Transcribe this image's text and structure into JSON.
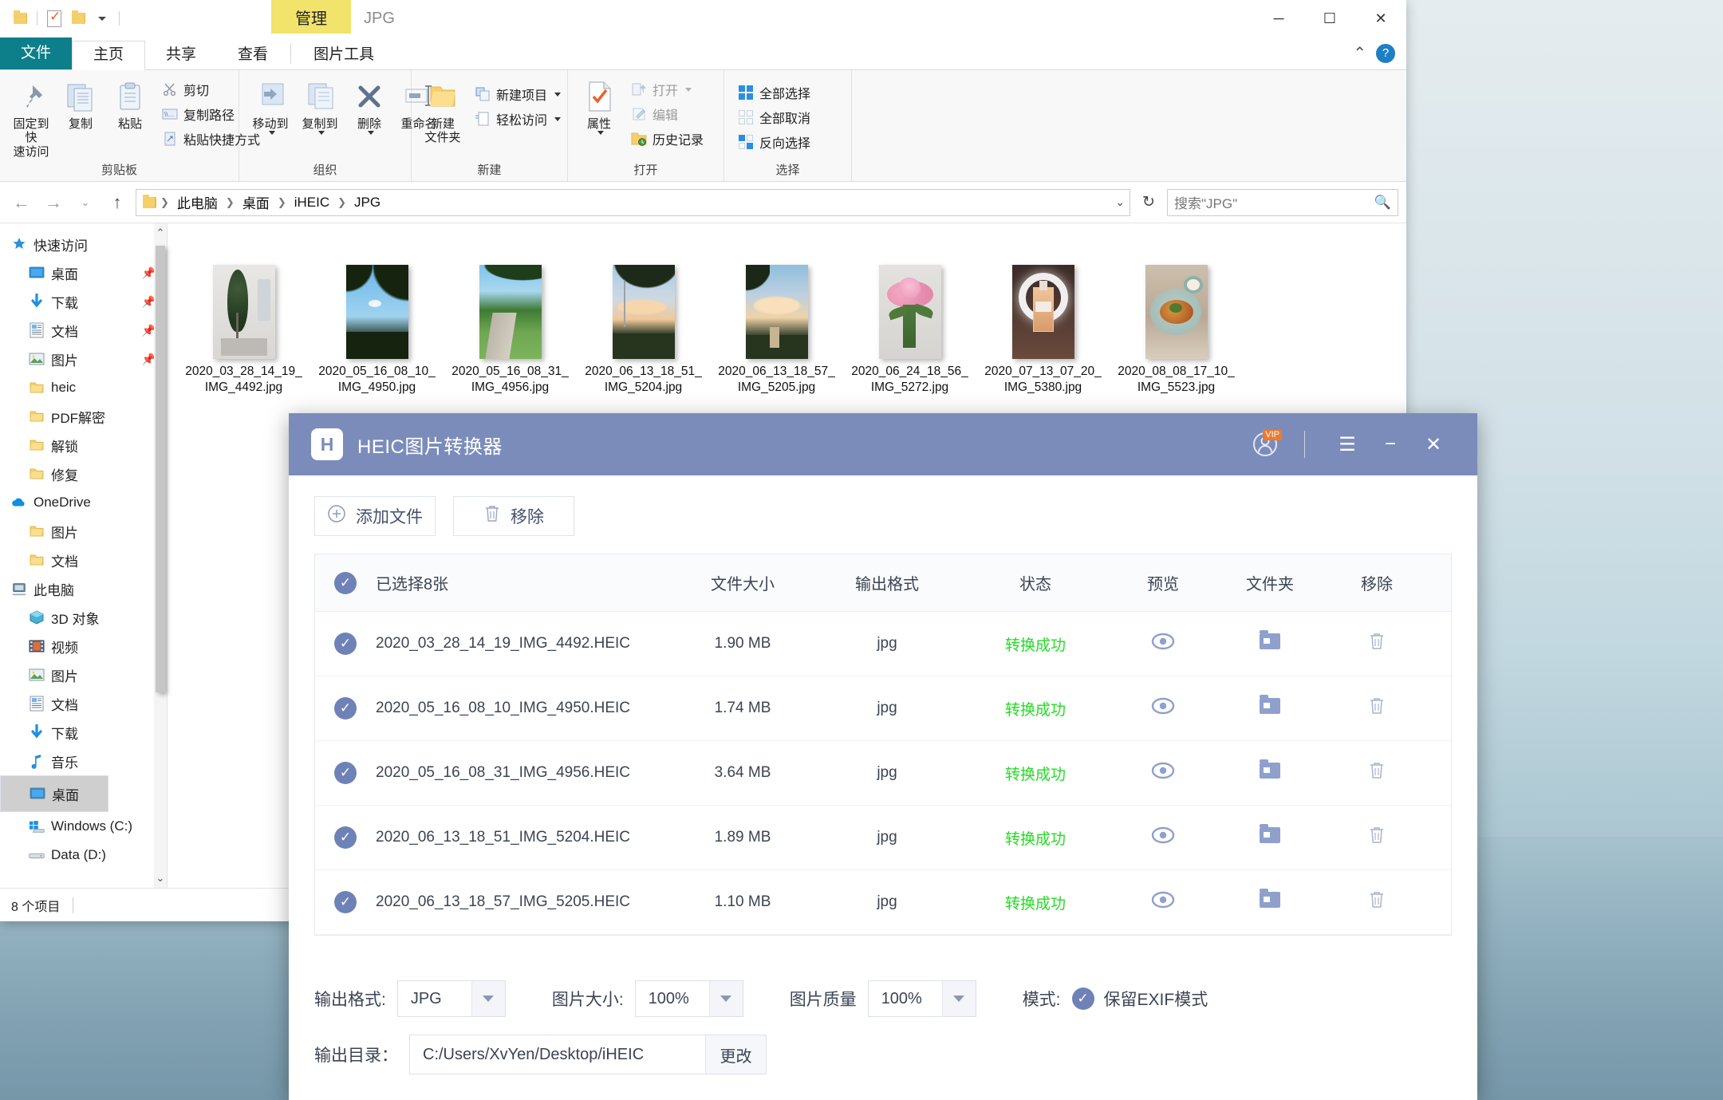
{
  "explorer": {
    "quick_access_toolbar": {
      "folder_icon": "folder-icon",
      "properties_icon": "properties-checkmark-icon",
      "new_folder_icon": "new-folder-icon",
      "customize_icon": "chevron-down-icon"
    },
    "contextual_tab": "管理",
    "contextual_caption": "JPG",
    "window_buttons": {
      "minimize": "─",
      "maximize": "☐",
      "close": "✕"
    },
    "ribbon_tabs": [
      {
        "label": "文件",
        "state": "file"
      },
      {
        "label": "主页",
        "state": "active"
      },
      {
        "label": "共享",
        "state": "normal"
      },
      {
        "label": "查看",
        "state": "normal"
      },
      {
        "label": "图片工具",
        "state": "contextual"
      }
    ],
    "ribbon_right": {
      "collapse": "⌃",
      "help": "?"
    },
    "ribbon_groups": [
      {
        "label": "剪贴板",
        "big": [
          {
            "label": "固定到快\n速访问",
            "icon": "pin-icon"
          },
          {
            "label": "复制",
            "icon": "copy-icon"
          },
          {
            "label": "粘贴",
            "icon": "paste-icon"
          }
        ],
        "small": [
          {
            "label": "剪切",
            "icon": "scissors-icon"
          },
          {
            "label": "复制路径",
            "icon": "copy-path-icon"
          },
          {
            "label": "粘贴快捷方式",
            "icon": "paste-shortcut-icon"
          }
        ]
      },
      {
        "label": "组织",
        "big": [
          {
            "label": "移动到",
            "icon": "move-to-icon",
            "dropdown": true
          },
          {
            "label": "复制到",
            "icon": "copy-to-icon",
            "dropdown": true
          },
          {
            "label": "删除",
            "icon": "delete-x-icon",
            "dropdown": true
          },
          {
            "label": "重命名",
            "icon": "rename-icon"
          }
        ],
        "small": []
      },
      {
        "label": "新建",
        "big": [
          {
            "label": "新建\n文件夹",
            "icon": "new-folder-icon"
          }
        ],
        "small": [
          {
            "label": "新建项目",
            "icon": "new-item-icon",
            "dropdown": true
          },
          {
            "label": "轻松访问",
            "icon": "easy-access-icon",
            "dropdown": true
          }
        ]
      },
      {
        "label": "打开",
        "big": [
          {
            "label": "属性",
            "icon": "properties-icon",
            "dropdown": true
          }
        ],
        "small": [
          {
            "label": "打开",
            "icon": "open-icon",
            "dropdown": true,
            "dim": true
          },
          {
            "label": "编辑",
            "icon": "edit-icon",
            "dim": true
          },
          {
            "label": "历史记录",
            "icon": "history-icon"
          }
        ]
      },
      {
        "label": "选择",
        "big": [],
        "small": [
          {
            "label": "全部选择",
            "icon": "select-all-icon"
          },
          {
            "label": "全部取消",
            "icon": "select-none-icon",
            "dim": true
          },
          {
            "label": "反向选择",
            "icon": "invert-selection-icon"
          }
        ]
      }
    ],
    "address": {
      "back_icon": "back-arrow-icon",
      "forward_icon": "forward-arrow-icon",
      "recent_icon": "chevron-down-icon",
      "up_icon": "up-arrow-icon",
      "breadcrumbs": [
        "此电脑",
        "桌面",
        "iHEIC",
        "JPG"
      ],
      "dropdown_icon": "chevron-down-icon",
      "refresh_icon": "refresh-icon",
      "search_placeholder": "搜索\"JPG\"",
      "search_icon": "search-icon"
    },
    "nav_pane": [
      {
        "label": "快速访问",
        "icon": "star-pin-icon",
        "level": 0,
        "pinned": false
      },
      {
        "label": "桌面",
        "icon": "desktop-icon",
        "level": 1,
        "pinned": true
      },
      {
        "label": "下载",
        "icon": "download-arrow-icon",
        "level": 1,
        "pinned": true
      },
      {
        "label": "文档",
        "icon": "documents-icon",
        "level": 1,
        "pinned": true
      },
      {
        "label": "图片",
        "icon": "pictures-icon",
        "level": 1,
        "pinned": true
      },
      {
        "label": "heic",
        "icon": "folder-icon",
        "level": 1,
        "pinned": false
      },
      {
        "label": "PDF解密",
        "icon": "folder-icon",
        "level": 1,
        "pinned": false
      },
      {
        "label": "解锁",
        "icon": "folder-icon",
        "level": 1,
        "pinned": false
      },
      {
        "label": "修复",
        "icon": "folder-icon",
        "level": 1,
        "pinned": false
      },
      {
        "label": "OneDrive",
        "icon": "onedrive-cloud-icon",
        "level": 0,
        "pinned": false
      },
      {
        "label": "图片",
        "icon": "folder-icon",
        "level": 1,
        "pinned": false
      },
      {
        "label": "文档",
        "icon": "folder-icon",
        "level": 1,
        "pinned": false
      },
      {
        "label": "此电脑",
        "icon": "this-pc-icon",
        "level": 0,
        "pinned": false
      },
      {
        "label": "3D 对象",
        "icon": "3d-objects-icon",
        "level": 1,
        "pinned": false
      },
      {
        "label": "视频",
        "icon": "videos-icon",
        "level": 1,
        "pinned": false
      },
      {
        "label": "图片",
        "icon": "pictures-icon",
        "level": 1,
        "pinned": false
      },
      {
        "label": "文档",
        "icon": "documents-icon",
        "level": 1,
        "pinned": false
      },
      {
        "label": "下载",
        "icon": "download-arrow-icon",
        "level": 1,
        "pinned": false
      },
      {
        "label": "音乐",
        "icon": "music-note-icon",
        "level": 1,
        "pinned": false
      },
      {
        "label": "桌面",
        "icon": "desktop-icon",
        "level": 1,
        "pinned": false,
        "selected": true
      },
      {
        "label": "Windows (C:)",
        "icon": "windows-drive-icon",
        "level": 1,
        "pinned": false
      },
      {
        "label": "Data (D:)",
        "icon": "drive-icon",
        "level": 1,
        "pinned": false
      }
    ],
    "files": [
      {
        "name": "2020_03_28_14_19_IMG_4492.jpg",
        "thumb": "interior-tree-cafe"
      },
      {
        "name": "2020_05_16_08_10_IMG_4950.jpg",
        "thumb": "palm-sky"
      },
      {
        "name": "2020_05_16_08_31_IMG_4956.jpg",
        "thumb": "park-path"
      },
      {
        "name": "2020_06_13_18_51_IMG_5204.jpg",
        "thumb": "sunset-clouds-a"
      },
      {
        "name": "2020_06_13_18_57_IMG_5205.jpg",
        "thumb": "sunset-clouds-b"
      },
      {
        "name": "2020_06_24_18_56_IMG_5272.jpg",
        "thumb": "pink-roses"
      },
      {
        "name": "2020_07_13_07_20_IMG_5380.jpg",
        "thumb": "perfume-ringlight"
      },
      {
        "name": "2020_08_08_17_10_IMG_5523.jpg",
        "thumb": "food-plate"
      }
    ],
    "status": "8 个项目"
  },
  "heic": {
    "logo_text": "H",
    "title": "HEIC图片转换器",
    "account_icon": "account-avatar-icon",
    "account_badge": "VIP",
    "menu_icon": "hamburger-menu-icon",
    "minimize_icon": "minimize-icon",
    "close_icon": "close-icon",
    "toolbar": {
      "add_files": "添加文件",
      "add_files_icon": "plus-circle-icon",
      "remove": "移除",
      "remove_icon": "trash-icon"
    },
    "table": {
      "headers": {
        "check": "select-all-checkbox",
        "name": "已选择8张",
        "size": "文件大小",
        "format": "输出格式",
        "status": "状态",
        "preview": "预览",
        "folder": "文件夹",
        "remove": "移除"
      },
      "rows": [
        {
          "checked": true,
          "name": "2020_03_28_14_19_IMG_4492.HEIC",
          "size": "1.90 MB",
          "format": "jpg",
          "status": "转换成功"
        },
        {
          "checked": true,
          "name": "2020_05_16_08_10_IMG_4950.HEIC",
          "size": "1.74 MB",
          "format": "jpg",
          "status": "转换成功"
        },
        {
          "checked": true,
          "name": "2020_05_16_08_31_IMG_4956.HEIC",
          "size": "3.64 MB",
          "format": "jpg",
          "status": "转换成功"
        },
        {
          "checked": true,
          "name": "2020_06_13_18_51_IMG_5204.HEIC",
          "size": "1.89 MB",
          "format": "jpg",
          "status": "转换成功"
        },
        {
          "checked": true,
          "name": "2020_06_13_18_57_IMG_5205.HEIC",
          "size": "1.10 MB",
          "format": "jpg",
          "status": "转换成功"
        }
      ]
    },
    "settings": {
      "output_format_label": "输出格式:",
      "output_format_value": "JPG",
      "image_size_label": "图片大小:",
      "image_size_value": "100%",
      "image_quality_label": "图片质量",
      "image_quality_value": "100%",
      "mode_label": "模式:",
      "mode_value": "保留EXIF模式",
      "output_dir_label": "输出目录：",
      "output_dir_value": "C:/Users/XvYen/Desktop/iHEIC",
      "change_button": "更改"
    },
    "colors": {
      "accent": "#7b8cba",
      "success": "#22dd22",
      "badge": "#f0792c"
    }
  }
}
